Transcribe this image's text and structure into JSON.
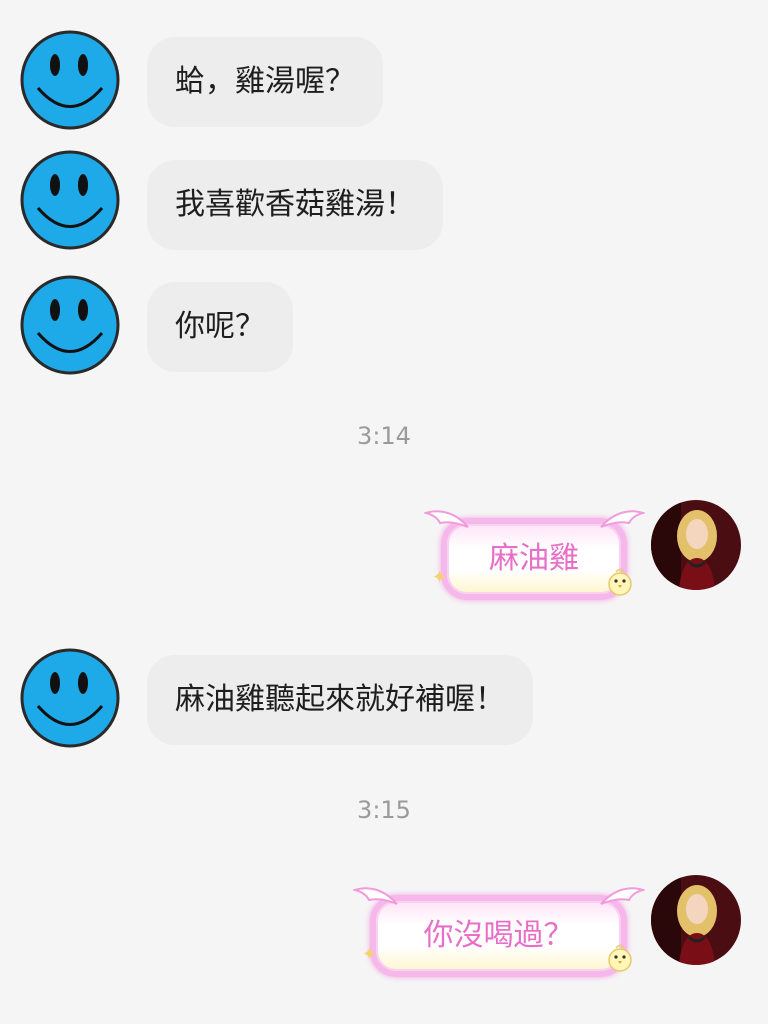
{
  "colors": {
    "background": "#f5f5f5",
    "incoming_bubble": "#ededed",
    "outgoing_text": "#e86fc8",
    "smiley_face": "#1ea9e8",
    "timestamp": "#9a9a9a"
  },
  "messages": [
    {
      "sender": "other",
      "avatar_icon": "smiley-icon",
      "text": "蛤，雞湯喔？"
    },
    {
      "sender": "other",
      "avatar_icon": "smiley-icon",
      "text": "我喜歡香菇雞湯！"
    },
    {
      "sender": "other",
      "avatar_icon": "smiley-icon",
      "text": "你呢？"
    },
    {
      "type": "time",
      "text": "3:14"
    },
    {
      "sender": "me",
      "avatar_icon": "user-photo-avatar",
      "text": "麻油雞"
    },
    {
      "sender": "other",
      "avatar_icon": "smiley-icon",
      "text": "麻油雞聽起來就好補喔！"
    },
    {
      "type": "time",
      "text": "3:15"
    },
    {
      "sender": "me",
      "avatar_icon": "user-photo-avatar",
      "text": "你沒喝過？"
    }
  ]
}
